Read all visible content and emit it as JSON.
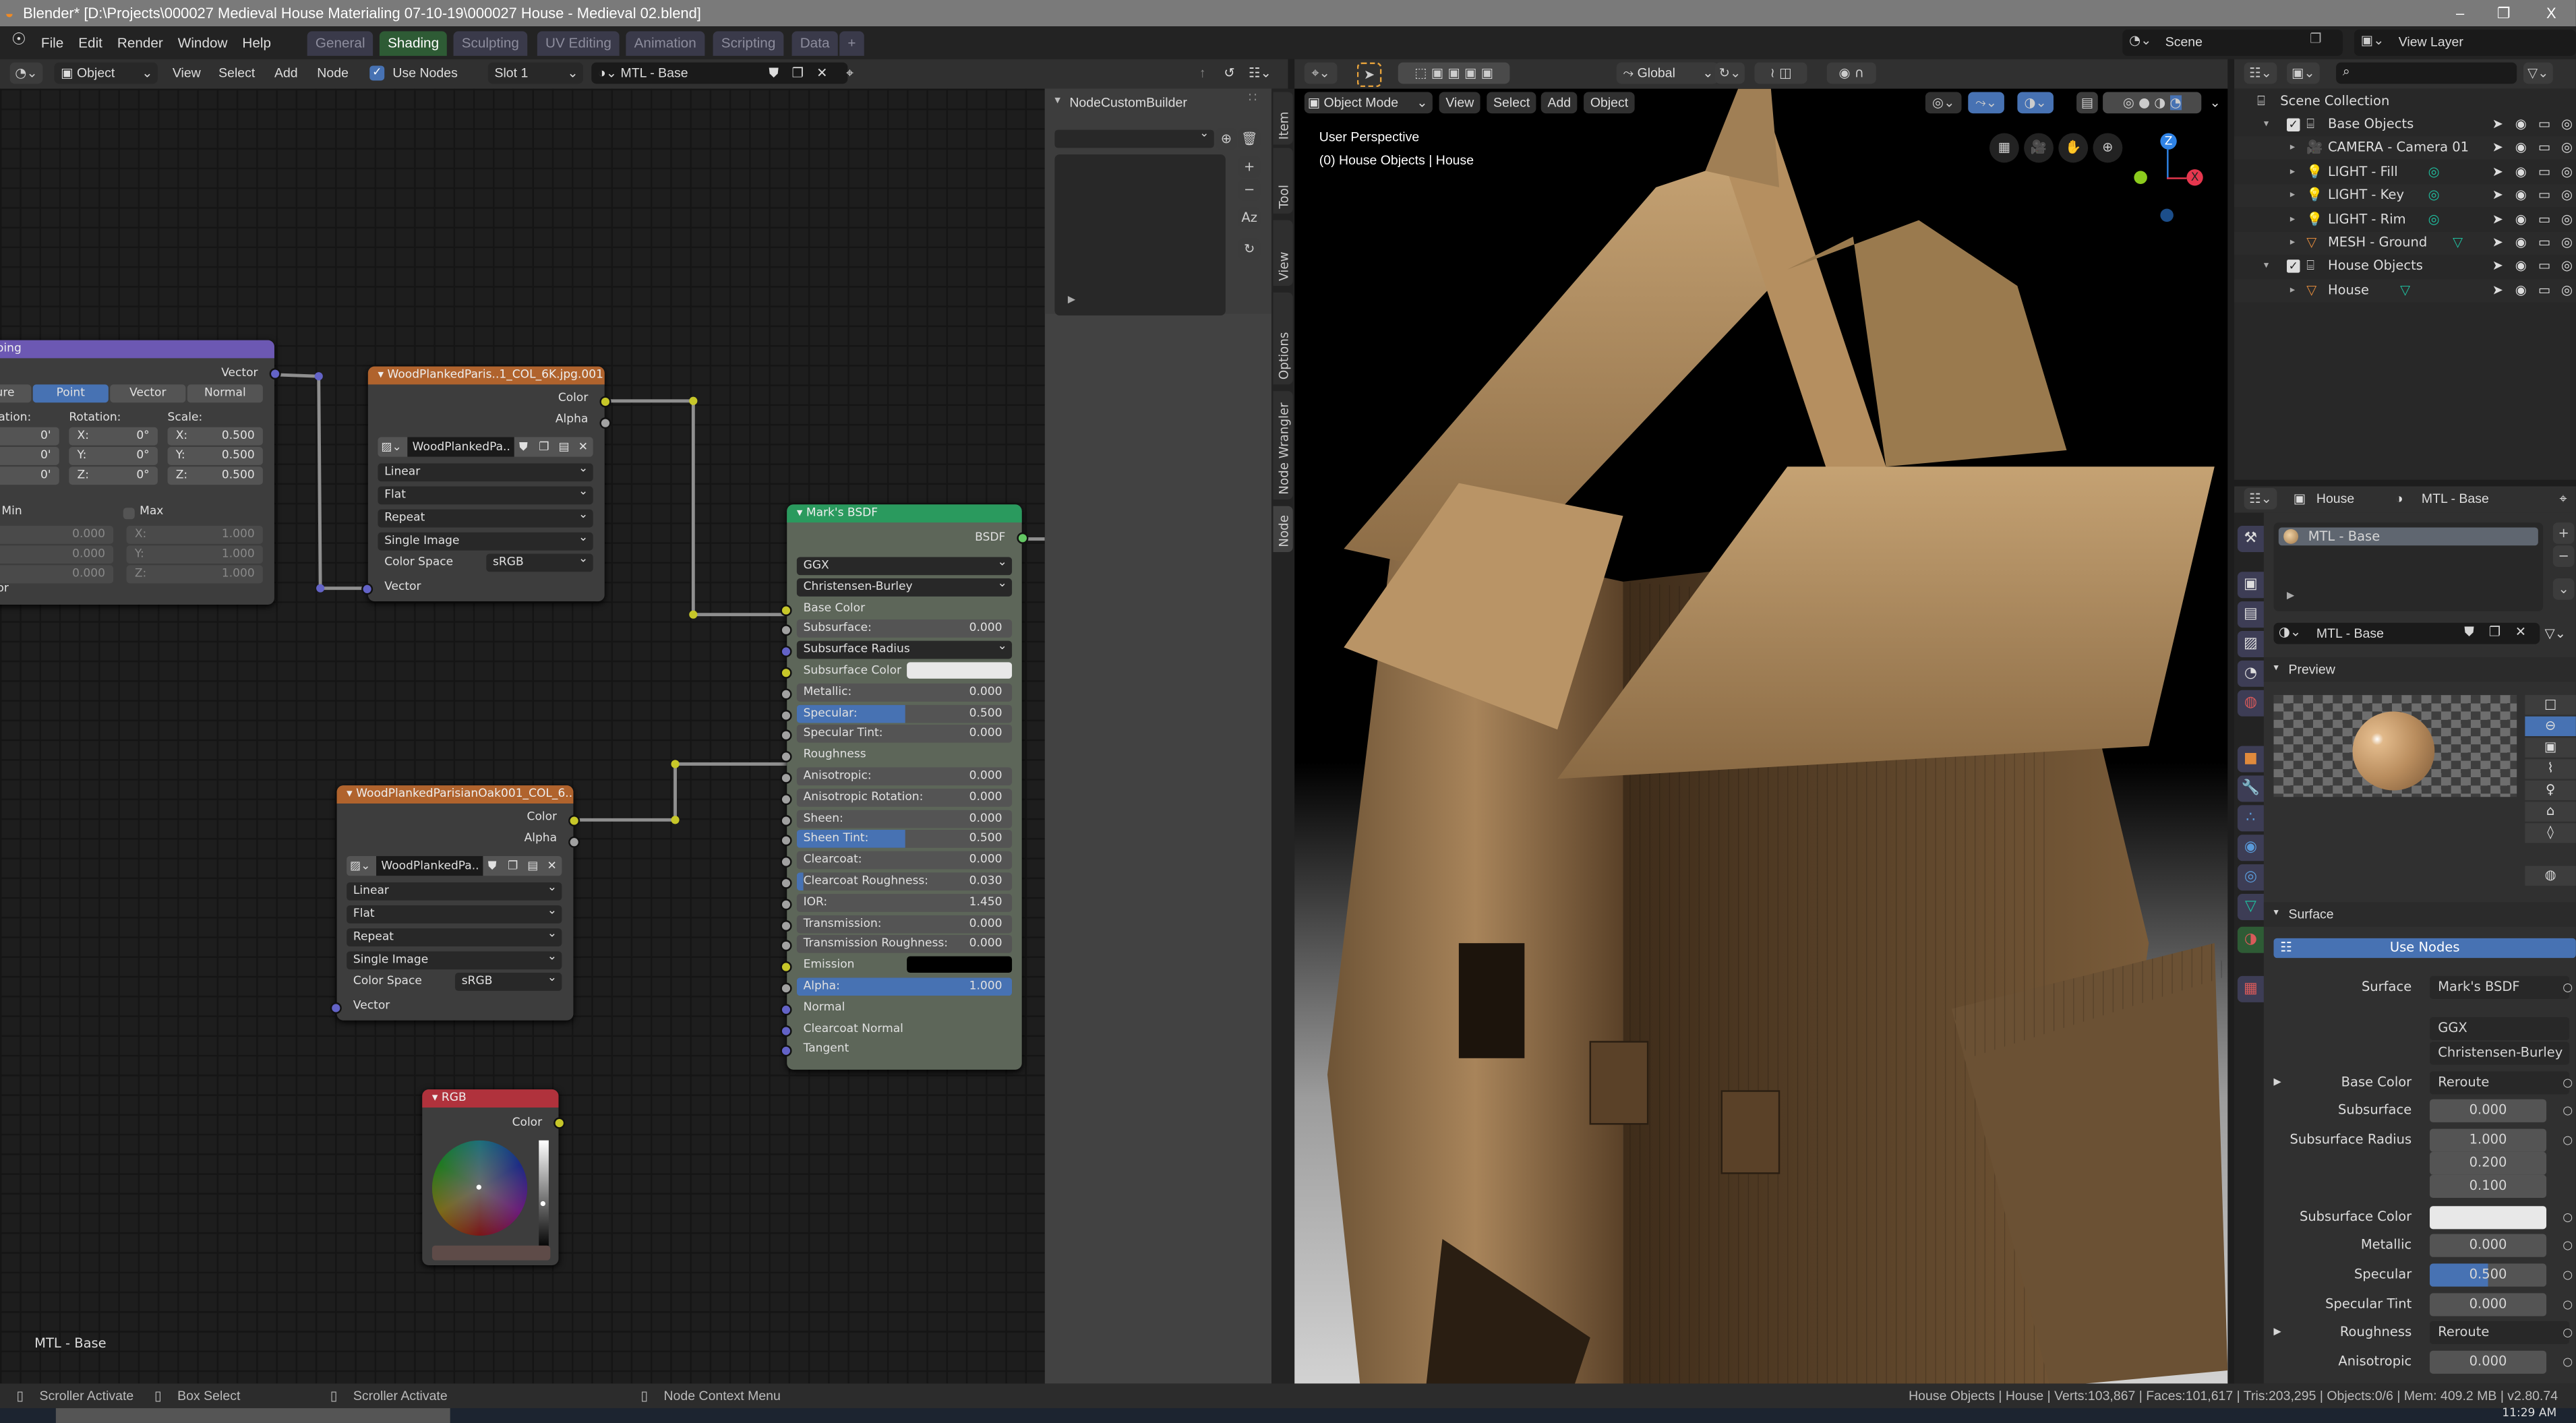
{
  "window": {
    "title": "Blender* [D:\\Projects\\000027 Medieval House Materialing 07-10-19\\000027 House - Medieval 02.blend]",
    "minimize": "–",
    "maximize": "❐",
    "close": "X"
  },
  "menu": [
    "File",
    "Edit",
    "Render",
    "Window",
    "Help"
  ],
  "workspaces": [
    {
      "label": "General",
      "active": false
    },
    {
      "label": "Shading",
      "active": true
    },
    {
      "label": "Sculpting",
      "active": false
    },
    {
      "label": "UV Editing",
      "active": false
    },
    {
      "label": "Animation",
      "active": false
    },
    {
      "label": "Scripting",
      "active": false
    },
    {
      "label": "Data",
      "active": false
    },
    {
      "label": "+",
      "active": false
    }
  ],
  "scene": "Scene",
  "view_layer": "View Layer",
  "node_header": {
    "object_mode": "Object",
    "menus": [
      "View",
      "Select",
      "Add",
      "Node"
    ],
    "use_nodes": "Use Nodes",
    "use_nodes_checked": true,
    "slot": "Slot 1",
    "material": "MTL - Base"
  },
  "viewport_header": {
    "transform": "Global",
    "mode": "Object Mode",
    "menus": [
      "View",
      "Select",
      "Add",
      "Object"
    ]
  },
  "viewport": {
    "perspective": "User Perspective",
    "context": "(0) House Objects | House",
    "axis_z": "Z",
    "axis_x": "X"
  },
  "sidebar": {
    "panel_title": "NodeCustomBuilder",
    "tabs": [
      "Item",
      "Tool",
      "View",
      "Options",
      "Node Wrangler",
      "Node"
    ],
    "active_tab": "Node"
  },
  "frame_label": "MTL - Base",
  "mapping_node": {
    "title": "Mapping",
    "output": "Vector",
    "types": [
      "Texture",
      "Point",
      "Vector",
      "Normal"
    ],
    "active_type": "Point",
    "col_labels": [
      "Location:",
      "Rotation:",
      "Scale:"
    ],
    "location": [
      "0'",
      "0'",
      "0'"
    ],
    "rotation": [
      [
        "X:",
        "0°"
      ],
      [
        "Y:",
        "0°"
      ],
      [
        "Z:",
        "0°"
      ]
    ],
    "scale": [
      [
        "X:",
        "0.500"
      ],
      [
        "Y:",
        "0.500"
      ],
      [
        "Z:",
        "0.500"
      ]
    ],
    "min_label": "Min",
    "max_label": "Max",
    "min": [
      "0.000",
      "0.000",
      "0.000"
    ],
    "max": [
      [
        "X:",
        "1.000"
      ],
      [
        "Y:",
        "1.000"
      ],
      [
        "Z:",
        "1.000"
      ]
    ],
    "input": "Vector"
  },
  "image_nodes": [
    {
      "title": "WoodPlankedParis..1_COL_6K.jpg.001",
      "out_color": "Color",
      "out_alpha": "Alpha",
      "image": "WoodPlankedPa..",
      "interpolation": "Linear",
      "projection": "Flat",
      "extension": "Repeat",
      "source": "Single Image",
      "color_space_label": "Color Space",
      "color_space": "sRGB",
      "input": "Vector"
    },
    {
      "title": "WoodPlankedParisianOak001_COL_6..",
      "out_color": "Color",
      "out_alpha": "Alpha",
      "image": "WoodPlankedPa..",
      "interpolation": "Linear",
      "projection": "Flat",
      "extension": "Repeat",
      "source": "Single Image",
      "color_space_label": "Color Space",
      "color_space": "sRGB",
      "input": "Vector"
    }
  ],
  "bsdf_node": {
    "title": "Mark's BSDF",
    "output": "BSDF",
    "rows": [
      {
        "type": "dropdown",
        "label": "GGX"
      },
      {
        "type": "dropdown",
        "label": "Christensen-Burley"
      },
      {
        "type": "socket",
        "label": "Base Color",
        "socket": "yel"
      },
      {
        "type": "value",
        "label": "Subsurface:",
        "value": "0.000",
        "fill": 0,
        "socket": "gry"
      },
      {
        "type": "dropdown",
        "label": "Subsurface Radius",
        "socket": "blu"
      },
      {
        "type": "color",
        "label": "Subsurface Color",
        "color": "#e8e8e8",
        "socket": "yel"
      },
      {
        "type": "value",
        "label": "Metallic:",
        "value": "0.000",
        "fill": 0,
        "socket": "gry"
      },
      {
        "type": "value",
        "label": "Specular:",
        "value": "0.500",
        "fill": 0.5,
        "socket": "gry"
      },
      {
        "type": "value",
        "label": "Specular Tint:",
        "value": "0.000",
        "fill": 0,
        "socket": "gry"
      },
      {
        "type": "socket",
        "label": "Roughness",
        "socket": "gry"
      },
      {
        "type": "value",
        "label": "Anisotropic:",
        "value": "0.000",
        "fill": 0,
        "socket": "gry"
      },
      {
        "type": "value",
        "label": "Anisotropic Rotation:",
        "value": "0.000",
        "fill": 0,
        "socket": "gry"
      },
      {
        "type": "value",
        "label": "Sheen:",
        "value": "0.000",
        "fill": 0,
        "socket": "gry"
      },
      {
        "type": "value",
        "label": "Sheen Tint:",
        "value": "0.500",
        "fill": 0.5,
        "socket": "gry"
      },
      {
        "type": "value",
        "label": "Clearcoat:",
        "value": "0.000",
        "fill": 0,
        "socket": "gry"
      },
      {
        "type": "value",
        "label": "Clearcoat Roughness:",
        "value": "0.030",
        "fill": 0.03,
        "socket": "gry"
      },
      {
        "type": "value",
        "label": "IOR:",
        "value": "1.450",
        "fill": 0,
        "socket": "gry"
      },
      {
        "type": "value",
        "label": "Transmission:",
        "value": "0.000",
        "fill": 0,
        "socket": "gry"
      },
      {
        "type": "value",
        "label": "Transmission Roughness:",
        "value": "0.000",
        "fill": 0,
        "socket": "gry"
      },
      {
        "type": "color",
        "label": "Emission",
        "color": "#000000",
        "socket": "yel"
      },
      {
        "type": "value",
        "label": "Alpha:",
        "value": "1.000",
        "fill": 1,
        "socket": "gry"
      },
      {
        "type": "socket",
        "label": "Normal",
        "socket": "blu"
      },
      {
        "type": "socket",
        "label": "Clearcoat Normal",
        "socket": "blu"
      },
      {
        "type": "socket",
        "label": "Tangent",
        "socket": "blu"
      }
    ]
  },
  "rgb_node": {
    "title": "RGB",
    "output": "Color",
    "swatch": "#5e4b48"
  },
  "outliner": {
    "root": "Scene Collection",
    "items": [
      {
        "label": "Base Objects",
        "kind": "collection",
        "level": 0
      },
      {
        "label": "CAMERA - Camera 01",
        "kind": "camera",
        "level": 1
      },
      {
        "label": "LIGHT - Fill",
        "kind": "light",
        "level": 1
      },
      {
        "label": "LIGHT - Key",
        "kind": "light",
        "level": 1
      },
      {
        "label": "LIGHT - Rim",
        "kind": "light",
        "level": 1
      },
      {
        "label": "MESH - Ground",
        "kind": "mesh",
        "level": 1
      },
      {
        "label": "House Objects",
        "kind": "collection",
        "level": 0
      },
      {
        "label": "House",
        "kind": "mesh",
        "level": 1
      }
    ]
  },
  "properties": {
    "object": "House",
    "material": "MTL - Base",
    "slot_item": "MTL - Base",
    "material_field": "MTL - Base",
    "preview_label": "Preview",
    "surface_label": "Surface",
    "use_nodes": "Use Nodes",
    "rows": [
      {
        "label": "Surface",
        "kind": "link",
        "value": "Mark's BSDF"
      },
      {
        "label": "",
        "kind": "dropdown",
        "value": "GGX"
      },
      {
        "label": "",
        "kind": "dropdown",
        "value": "Christensen-Burley"
      },
      {
        "label": "Base Color",
        "kind": "link",
        "value": "Reroute",
        "expand": true
      },
      {
        "label": "Subsurface",
        "kind": "value",
        "value": "0.000",
        "fill": 0
      },
      {
        "label": "Subsurface Radius",
        "kind": "value",
        "value": "1.000",
        "fill": 0
      },
      {
        "label": "",
        "kind": "value",
        "value": "0.200",
        "fill": 0
      },
      {
        "label": "",
        "kind": "value",
        "value": "0.100",
        "fill": 0
      },
      {
        "label": "Subsurface Color",
        "kind": "color",
        "value": "",
        "color": "#e8e8e8"
      },
      {
        "label": "Metallic",
        "kind": "value",
        "value": "0.000",
        "fill": 0
      },
      {
        "label": "Specular",
        "kind": "value",
        "value": "0.500",
        "fill": 0.5
      },
      {
        "label": "Specular Tint",
        "kind": "value",
        "value": "0.000",
        "fill": 0
      },
      {
        "label": "Roughness",
        "kind": "link",
        "value": "Reroute",
        "expand": true
      },
      {
        "label": "Anisotropic",
        "kind": "value",
        "value": "0.000",
        "fill": 0
      }
    ]
  },
  "status": {
    "hints": [
      "Scroller Activate",
      "Box Select",
      "Scroller Activate",
      "Node Context Menu"
    ],
    "stats": "House Objects | House | Verts:103,867 | Faces:101,617 | Tris:203,295 | Objects:0/6 | Mem: 409.2 MB | v2.80.74"
  },
  "taskbar": {
    "time": "11:29 AM"
  },
  "colors": {
    "accent": "#4772b3",
    "active_workspace": "#2e5b35",
    "mapping": "#6c58b3",
    "texture": "#b0632d",
    "shader": "#2a9a5e",
    "rgb": "#b0323c",
    "wood": "#a8845a"
  }
}
